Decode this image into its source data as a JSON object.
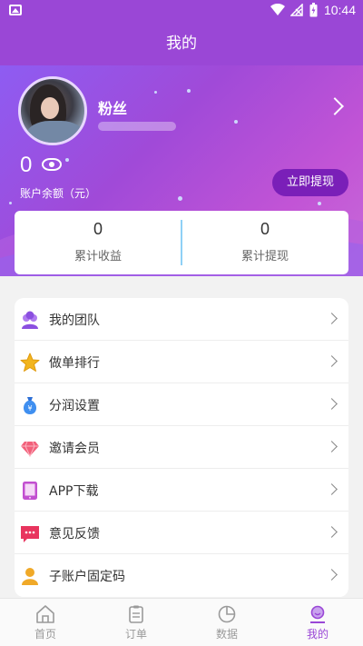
{
  "status_bar": {
    "time": "10:44"
  },
  "header": {
    "title": "我的"
  },
  "profile": {
    "nickname": "粉丝",
    "balance": "0",
    "balance_label": "账户余额（元）",
    "withdraw_button": "立即提现"
  },
  "stats": [
    {
      "value": "0",
      "label": "累计收益"
    },
    {
      "value": "0",
      "label": "累计提现"
    }
  ],
  "menu": [
    {
      "label": "我的团队",
      "icon": "team-icon"
    },
    {
      "label": "做单排行",
      "icon": "star-icon"
    },
    {
      "label": "分润设置",
      "icon": "money-bag-icon"
    },
    {
      "label": "邀请会员",
      "icon": "diamond-icon"
    },
    {
      "label": "APP下载",
      "icon": "tablet-icon"
    },
    {
      "label": "意见反馈",
      "icon": "feedback-icon"
    },
    {
      "label": "子账户固定码",
      "icon": "person-icon"
    }
  ],
  "tabs": [
    {
      "label": "首页",
      "icon": "home-icon",
      "active": false
    },
    {
      "label": "订单",
      "icon": "order-icon",
      "active": false
    },
    {
      "label": "数据",
      "icon": "chart-icon",
      "active": false
    },
    {
      "label": "我的",
      "icon": "profile-icon",
      "active": true
    }
  ],
  "colors": {
    "primary": "#9a47d6",
    "accent_button": "#7a1fb8",
    "divider": "#8fd0f6"
  }
}
